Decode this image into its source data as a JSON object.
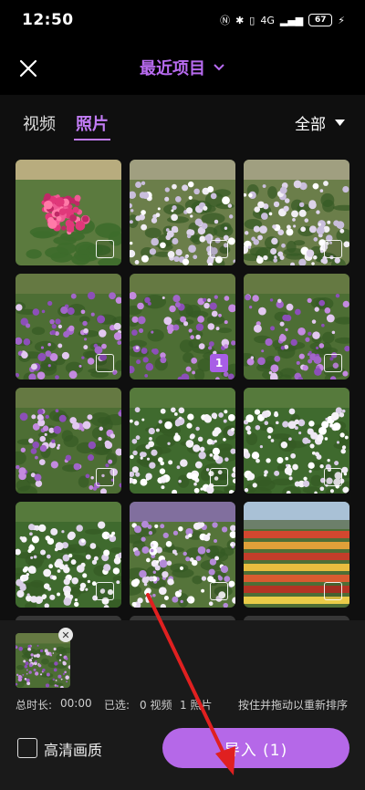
{
  "status_bar": {
    "time": "12:50",
    "network": "4G",
    "battery": "67"
  },
  "header": {
    "title": "最近项目"
  },
  "filters": {
    "tab_video": "视频",
    "tab_photo": "照片",
    "filter_all": "全部"
  },
  "grid": {
    "selected_badge": "1",
    "items": [
      {
        "theme": "pink"
      },
      {
        "theme": "white-field"
      },
      {
        "theme": "white-field"
      },
      {
        "theme": "purple"
      },
      {
        "theme": "purple",
        "selected": true
      },
      {
        "theme": "purple"
      },
      {
        "theme": "purple"
      },
      {
        "theme": "white"
      },
      {
        "theme": "white"
      },
      {
        "theme": "white"
      },
      {
        "theme": "lavender"
      },
      {
        "theme": "rows"
      },
      {
        "theme": "partial"
      },
      {
        "theme": "partial"
      },
      {
        "theme": "partial"
      }
    ]
  },
  "bottom": {
    "duration_label": "总时长:",
    "duration_value": "00:00",
    "selected_label": "已选:",
    "video_count": "0 视频",
    "photo_count": "1 照片",
    "hint": "按住并拖动以重新排序",
    "hq_label": "高清画质",
    "import_label": "导入 (1)"
  },
  "colors": {
    "accent": "#b568e8",
    "annotation": "#e02020"
  }
}
